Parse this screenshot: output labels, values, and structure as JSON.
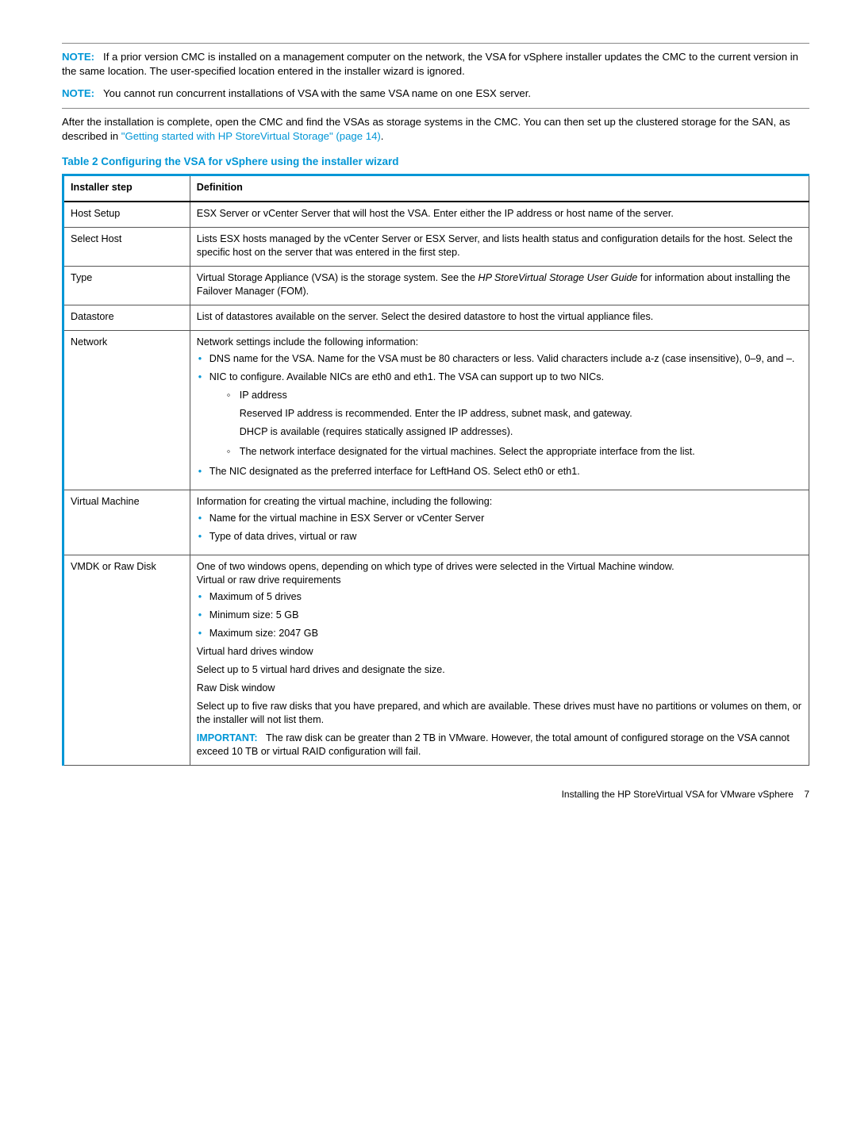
{
  "notes": {
    "note1": {
      "label": "NOTE:",
      "text": "If a prior version CMC is installed on a management computer on the network, the VSA for vSphere installer updates the CMC to the current version in the same location. The user-specified location entered in the installer wizard is ignored."
    },
    "note2": {
      "label": "NOTE:",
      "text": "You cannot run concurrent installations of VSA with the same VSA name on one ESX server."
    }
  },
  "intro": {
    "prelink": "After the installation is complete, open the CMC and find the VSAs as storage systems in the CMC. You can then set up the clustered storage for the SAN, as described in ",
    "link": "\"Getting started with HP StoreVirtual Storage\" (page 14)",
    "post": "."
  },
  "table": {
    "caption": "Table 2 Configuring the VSA for vSphere using the installer wizard",
    "headers": {
      "step": "Installer step",
      "def": "Definition"
    },
    "rows": {
      "host_setup": {
        "step": "Host Setup",
        "def": "ESX Server or vCenter Server that will host the VSA. Enter either the IP address or host name of the server."
      },
      "select_host": {
        "step": "Select Host",
        "def": "Lists ESX hosts managed by the vCenter Server or ESX Server, and lists health status and configuration details for the host. Select the specific host on the server that was entered in the first step."
      },
      "type": {
        "step": "Type",
        "pre": "Virtual Storage Appliance (VSA) is the storage system. See the ",
        "italic": "HP StoreVirtual Storage User Guide",
        "post": " for information about installing the Failover Manager (FOM)."
      },
      "datastore": {
        "step": "Datastore",
        "def": "List of datastores available on the server. Select the desired datastore to host the virtual appliance files."
      },
      "network": {
        "step": "Network",
        "lead": "Network settings include the following information:",
        "b1": "DNS name for the VSA. Name for the VSA must be 80 characters or less. Valid characters include a-z (case insensitive), 0–9, and –.",
        "b2": "NIC to configure. Available NICs are eth0 and eth1. The VSA can support up to two NICs.",
        "c1": "IP address",
        "c1p1": "Reserved IP address is recommended. Enter the IP address, subnet mask, and gateway.",
        "c1p2": "DHCP is available (requires statically assigned IP addresses).",
        "c2": "The network interface designated for the virtual machines. Select the appropriate interface from the list.",
        "b3": "The NIC designated as the preferred interface for LeftHand OS. Select eth0 or eth1."
      },
      "virtual_machine": {
        "step": "Virtual Machine",
        "lead": "Information for creating the virtual machine, including the following:",
        "b1": "Name for the virtual machine in ESX Server or vCenter Server",
        "b2": "Type of data drives, virtual or raw"
      },
      "vmdk": {
        "step": "VMDK or Raw Disk",
        "lead": "One of two windows opens, depending on which type of drives were selected in the Virtual Machine window.",
        "sub1": "Virtual or raw drive requirements",
        "b1": "Maximum of 5 drives",
        "b2": "Minimum size: 5 GB",
        "b3": "Maximum size: 2047 GB",
        "sub2": "Virtual hard drives window",
        "p2": "Select up to 5 virtual hard drives and designate the size.",
        "sub3": "Raw Disk window",
        "p3": "Select up to five raw disks that you have prepared, and which are available. These drives must have no partitions or volumes on them, or the installer will not list them.",
        "important_label": "IMPORTANT:",
        "important_text": "The raw disk can be greater than 2 TB in VMware. However, the total amount of configured storage on the VSA cannot exceed 10 TB or virtual RAID configuration will fail."
      }
    }
  },
  "footer": {
    "text": "Installing the HP StoreVirtual VSA for VMware vSphere",
    "page": "7"
  }
}
